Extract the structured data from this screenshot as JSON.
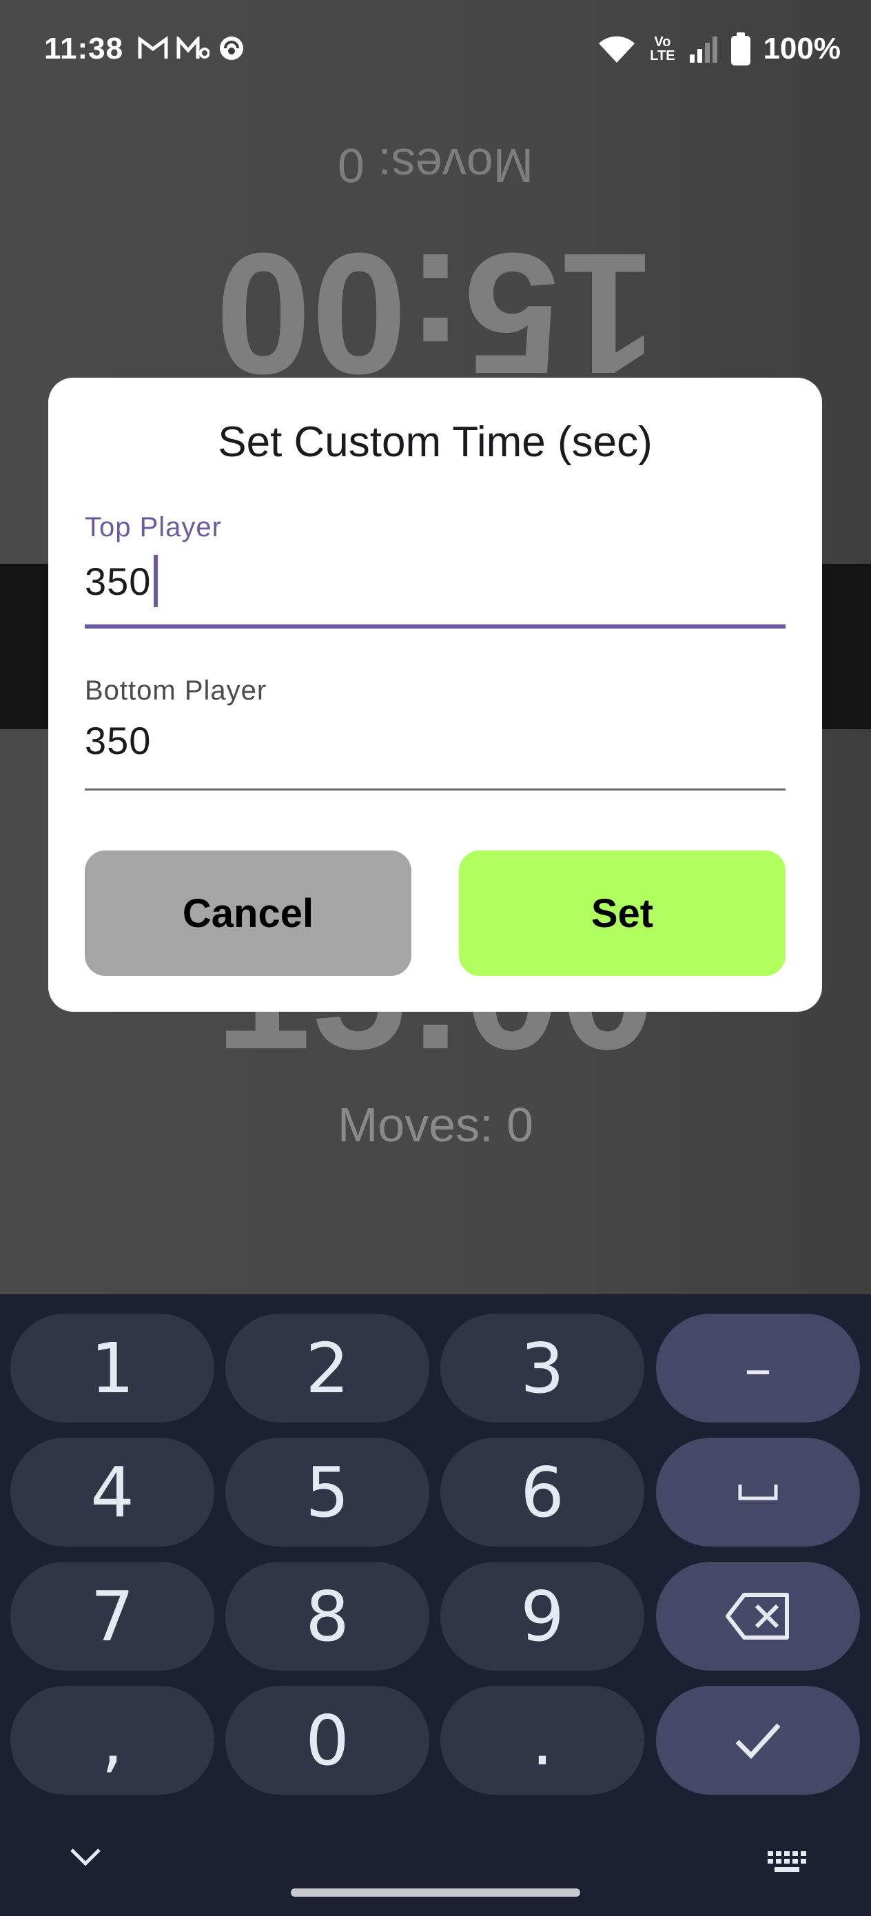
{
  "status_bar": {
    "time": "11:38",
    "battery": "100%",
    "network_label": "Vo LTE"
  },
  "background": {
    "top_moves": "Moves: 0",
    "top_time": "15:00",
    "bottom_time": "15:00",
    "bottom_moves": "Moves: 0"
  },
  "dialog": {
    "title": "Set Custom Time (sec)",
    "top_field": {
      "label": "Top Player",
      "value": "350"
    },
    "bottom_field": {
      "label": "Bottom Player",
      "value": "350"
    },
    "cancel_label": "Cancel",
    "set_label": "Set",
    "colors": {
      "accent": "#6d5a9e",
      "set_button": "#b0ff5f",
      "cancel_button": "#a5a5a5"
    }
  },
  "keyboard": {
    "keys": [
      "1",
      "2",
      "3",
      "–",
      "4",
      "5",
      "6",
      "␣",
      "7",
      "8",
      "9",
      "⌫",
      ",",
      "0",
      ".",
      "✓"
    ],
    "fn_icons": {
      "minus": "minus-key",
      "space": "space-key",
      "backspace": "backspace-icon",
      "enter": "check-icon"
    }
  }
}
